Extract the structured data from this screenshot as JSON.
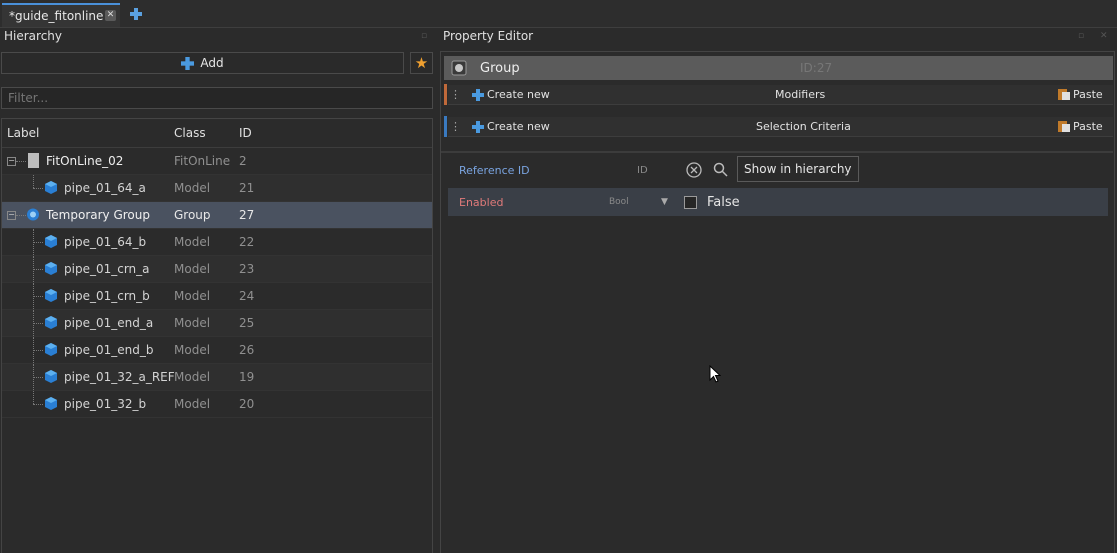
{
  "tab": {
    "title": "*guide_fitonline",
    "close": "✕"
  },
  "hierarchy": {
    "title": "Hierarchy",
    "add_label": "Add",
    "filter_placeholder": "Filter...",
    "columns": [
      "Label",
      "Class",
      "ID"
    ],
    "rows": [
      {
        "label": "FitOnLine_02",
        "class": "FitOnLine",
        "id": "2"
      },
      {
        "label": "pipe_01_64_a",
        "class": "Model",
        "id": "21"
      },
      {
        "label": "Temporary Group",
        "class": "Group",
        "id": "27"
      },
      {
        "label": "pipe_01_64_b",
        "class": "Model",
        "id": "22"
      },
      {
        "label": "pipe_01_crn_a",
        "class": "Model",
        "id": "23"
      },
      {
        "label": "pipe_01_crn_b",
        "class": "Model",
        "id": "24"
      },
      {
        "label": "pipe_01_end_a",
        "class": "Model",
        "id": "25"
      },
      {
        "label": "pipe_01_end_b",
        "class": "Model",
        "id": "26"
      },
      {
        "label": "pipe_01_32_a_REF",
        "class": "Model",
        "id": "19"
      },
      {
        "label": "pipe_01_32_b",
        "class": "Model",
        "id": "20"
      }
    ]
  },
  "property_editor": {
    "title": "Property Editor",
    "group_name": "Group",
    "group_id": "ID:27",
    "modifiers": {
      "create": "Create new",
      "title": "Modifiers",
      "paste": "Paste"
    },
    "selection": {
      "create": "Create new",
      "title": "Selection Criteria",
      "paste": "Paste"
    },
    "reference": {
      "label": "Reference ID",
      "type": "ID",
      "show_button": "Show in hierarchy"
    },
    "enabled": {
      "label": "Enabled",
      "type": "Bool",
      "value": "False"
    }
  },
  "colors": {
    "accent": "#4a90d9",
    "modifiers_marker": "#c0693a",
    "selection_marker": "#3a7ac0",
    "star": "#f0a030",
    "property_label": "#e07a7a",
    "reference_label": "#7aa4e0"
  }
}
